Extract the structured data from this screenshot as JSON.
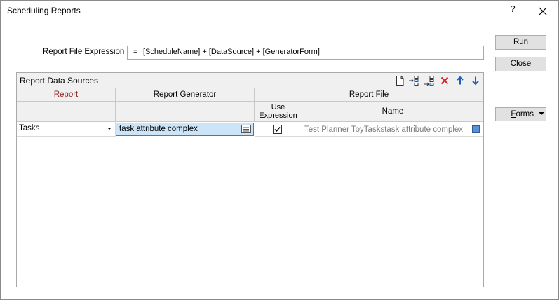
{
  "window": {
    "title": "Scheduling Reports",
    "help_glyph": "?",
    "close_icon": "close-icon"
  },
  "expression": {
    "label": "Report File Expression",
    "prefix": "=",
    "value": "[ScheduleName] + [DataSource] + [GeneratorForm]"
  },
  "buttons": {
    "run": "Run",
    "close": "Close",
    "forms_underlined": "F",
    "forms_rest": "orms"
  },
  "panel": {
    "title": "Report Data Sources",
    "toolbar_icons": [
      "new-row-icon",
      "insert-row-icon",
      "append-row-icon",
      "delete-row-icon",
      "move-up-icon",
      "move-down-icon"
    ],
    "columns": {
      "report": "Report",
      "report_generator": "Report Generator",
      "report_file": "Report File",
      "use_expression": "Use\nExpression",
      "use_expression_line1": "Use",
      "use_expression_line2": "Expression",
      "name": "Name"
    },
    "rows": [
      {
        "report": "Tasks",
        "generator": "task attribute complex",
        "use_expression": true,
        "name": "Test Planner ToyTaskstask attribute complex"
      }
    ]
  },
  "colors": {
    "report_header": "#8b1a1a",
    "selection_bg": "#cce4f7",
    "selection_border": "#3c7fb1",
    "delete_red": "#d42020",
    "arrow_blue": "#1c5fb8"
  }
}
